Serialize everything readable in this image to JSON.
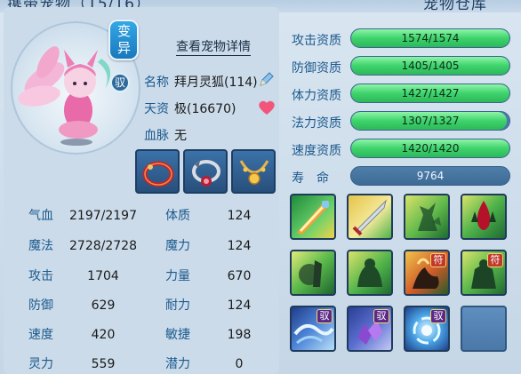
{
  "header": {
    "left_title_partial": "携带宠物（15/16）",
    "right_title_partial": "宠物仓库"
  },
  "pet": {
    "mutant_badge": "变异",
    "tame_badge": "驭",
    "detail_link": "查看宠物详情",
    "name_label": "名称",
    "name_value": "拜月灵狐(114)",
    "talent_label": "天资",
    "talent_value": "极(16670)",
    "bloodline_label": "血脉",
    "bloodline_value": "无"
  },
  "attributes": [
    {
      "label": "气血",
      "value": "2197/2197"
    },
    {
      "label": "魔法",
      "value": "2728/2728"
    },
    {
      "label": "攻击",
      "value": "1704"
    },
    {
      "label": "防御",
      "value": "629"
    },
    {
      "label": "速度",
      "value": "420"
    },
    {
      "label": "灵力",
      "value": "559"
    }
  ],
  "stats": [
    {
      "label": "体质",
      "value": "124"
    },
    {
      "label": "魔力",
      "value": "124"
    },
    {
      "label": "力量",
      "value": "670"
    },
    {
      "label": "耐力",
      "value": "124"
    },
    {
      "label": "敏捷",
      "value": "198"
    },
    {
      "label": "潜力",
      "value": "0"
    }
  ],
  "aptitudes": [
    {
      "label": "攻击资质",
      "text": "1574/1574",
      "fill": 1.0
    },
    {
      "label": "防御资质",
      "text": "1405/1405",
      "fill": 1.0
    },
    {
      "label": "体力资质",
      "text": "1427/1427",
      "fill": 1.0
    },
    {
      "label": "法力资质",
      "text": "1307/1327",
      "fill": 0.985
    },
    {
      "label": "速度资质",
      "text": "1420/1420",
      "fill": 1.0
    }
  ],
  "life": {
    "label": "寿　命",
    "value": "9764"
  },
  "skill_tags": {
    "fu": "符",
    "yu": "驭"
  },
  "equipment_icons": [
    "red-bracelet-icon",
    "silver-collar-icon",
    "gold-necklace-icon"
  ],
  "colors": {
    "label_blue": "#1c5a8d",
    "bar_green": "#3ed36c",
    "badge_blue": "#1a78bd"
  }
}
